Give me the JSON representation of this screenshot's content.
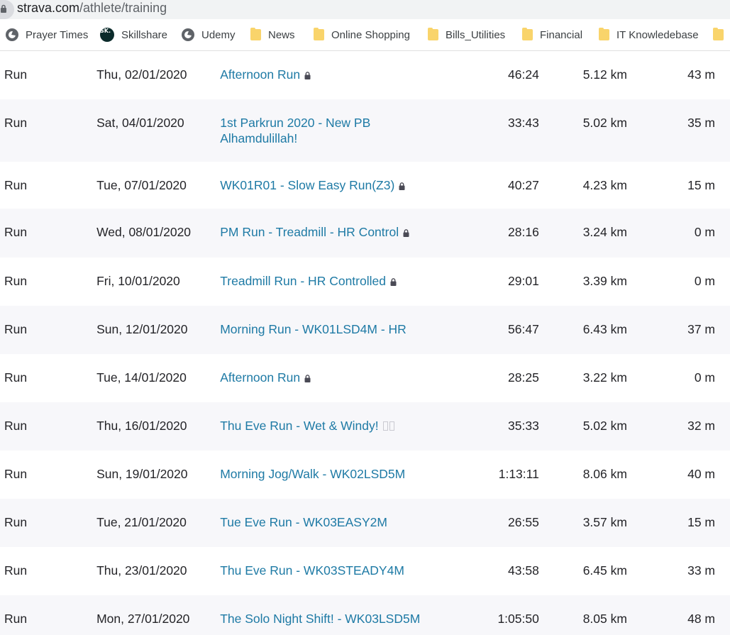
{
  "browser": {
    "url_domain": "strava.com",
    "url_path": "/athlete/training"
  },
  "bookmarks": [
    {
      "label": "Prayer Times",
      "icon": "globe-icon"
    },
    {
      "label": "Skillshare",
      "icon": "skillshare-icon",
      "badge": "SK."
    },
    {
      "label": "Udemy",
      "icon": "globe-icon"
    },
    {
      "label": "News",
      "icon": "folder-icon"
    },
    {
      "label": "Online Shopping",
      "icon": "folder-icon"
    },
    {
      "label": "Bills_Utilities",
      "icon": "folder-icon"
    },
    {
      "label": "Financial",
      "icon": "folder-icon"
    },
    {
      "label": "IT Knowledebase",
      "icon": "folder-icon"
    }
  ],
  "activities": [
    {
      "type": "Run",
      "date": "Thu, 02/01/2020",
      "name": "Afternoon Run",
      "name_line2": "",
      "private": true,
      "time": "46:24",
      "distance": "5.12 km",
      "elevation": "43 m"
    },
    {
      "type": "Run",
      "date": "Sat, 04/01/2020",
      "name": "1st Parkrun 2020 - New PB",
      "name_line2": "Alhamdulillah!",
      "private": false,
      "time": "33:43",
      "distance": "5.02 km",
      "elevation": "35 m"
    },
    {
      "type": "Run",
      "date": "Tue, 07/01/2020",
      "name": "WK01R01 - Slow Easy Run(Z3)",
      "name_line2": "",
      "private": true,
      "time": "40:27",
      "distance": "4.23 km",
      "elevation": "15 m"
    },
    {
      "type": "Run",
      "date": "Wed, 08/01/2020",
      "name": "PM Run - Treadmill - HR Control",
      "name_line2": "",
      "private": true,
      "time": "28:16",
      "distance": "3.24 km",
      "elevation": "0 m"
    },
    {
      "type": "Run",
      "date": "Fri, 10/01/2020",
      "name": "Treadmill Run - HR Controlled",
      "name_line2": "",
      "private": true,
      "time": "29:01",
      "distance": "3.39 km",
      "elevation": "0 m"
    },
    {
      "type": "Run",
      "date": "Sun, 12/01/2020",
      "name": "Morning Run - WK01LSD4M - HR",
      "name_line2": "",
      "private": false,
      "time": "56:47",
      "distance": "6.43 km",
      "elevation": "37 m"
    },
    {
      "type": "Run",
      "date": "Tue, 14/01/2020",
      "name": "Afternoon Run",
      "name_line2": "",
      "private": true,
      "time": "28:25",
      "distance": "3.22 km",
      "elevation": "0 m"
    },
    {
      "type": "Run",
      "date": "Thu, 16/01/2020",
      "name": "Thu Eve Run - Wet & Windy!",
      "name_line2": "",
      "private": false,
      "missing_glyphs": true,
      "time": "35:33",
      "distance": "5.02 km",
      "elevation": "32 m"
    },
    {
      "type": "Run",
      "date": "Sun, 19/01/2020",
      "name": "Morning Jog/Walk - WK02LSD5M",
      "name_line2": "",
      "private": false,
      "time": "1:13:11",
      "distance": "8.06 km",
      "elevation": "40 m"
    },
    {
      "type": "Run",
      "date": "Tue, 21/01/2020",
      "name": "Tue Eve Run - WK03EASY2M",
      "name_line2": "",
      "private": false,
      "time": "26:55",
      "distance": "3.57 km",
      "elevation": "15 m"
    },
    {
      "type": "Run",
      "date": "Thu, 23/01/2020",
      "name": "Thu Eve Run - WK03STEADY4M",
      "name_line2": "",
      "private": false,
      "time": "43:58",
      "distance": "6.45 km",
      "elevation": "33 m"
    },
    {
      "type": "Run",
      "date": "Mon, 27/01/2020",
      "name": "The Solo Night Shift! - WK03LSD5M",
      "name_line2": "",
      "private": false,
      "time": "1:05:50",
      "distance": "8.05 km",
      "elevation": "48 m"
    }
  ]
}
